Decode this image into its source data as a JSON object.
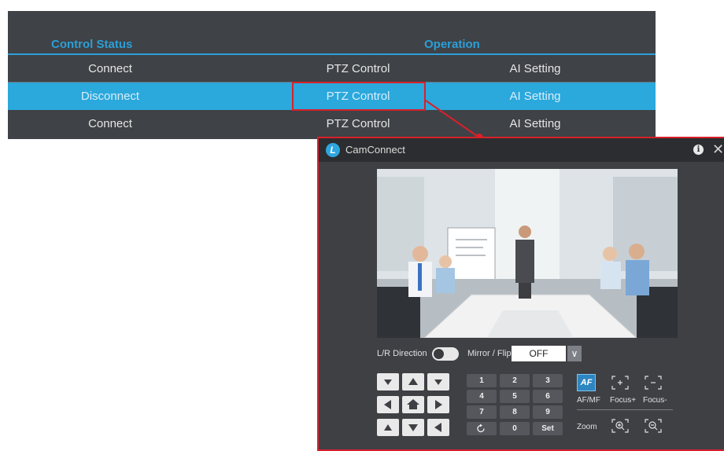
{
  "table": {
    "headers": {
      "status": "Control Status",
      "operation": "Operation"
    },
    "rows": [
      {
        "status": "Connect",
        "ptz": "PTZ Control",
        "ai": "AI Setting",
        "selected": false
      },
      {
        "status": "Disconnect",
        "ptz": "PTZ Control",
        "ai": "AI Setting",
        "selected": true
      },
      {
        "status": "Connect",
        "ptz": "PTZ Control",
        "ai": "AI Setting",
        "selected": false
      }
    ]
  },
  "window": {
    "title": "CamConnect",
    "logo_letter": "L",
    "icons": {
      "info": "info-icon",
      "close": "close-icon"
    }
  },
  "controls": {
    "lr_direction_label": "L/R Direction",
    "lr_direction_on": false,
    "mirror_flip_label": "Mirror / Flip",
    "mirror_flip_value": "OFF",
    "numpad": [
      "1",
      "2",
      "3",
      "4",
      "5",
      "6",
      "7",
      "8",
      "9",
      "",
      "0",
      "Set"
    ],
    "af_button": "AF",
    "af_mf_label": "AF/MF",
    "focus_plus_label": "Focus+",
    "focus_minus_label": "Focus-",
    "zoom_label": "Zoom"
  },
  "colors": {
    "accent": "#2ba8dc",
    "highlight": "#d8202a",
    "panel": "#3f4246"
  }
}
